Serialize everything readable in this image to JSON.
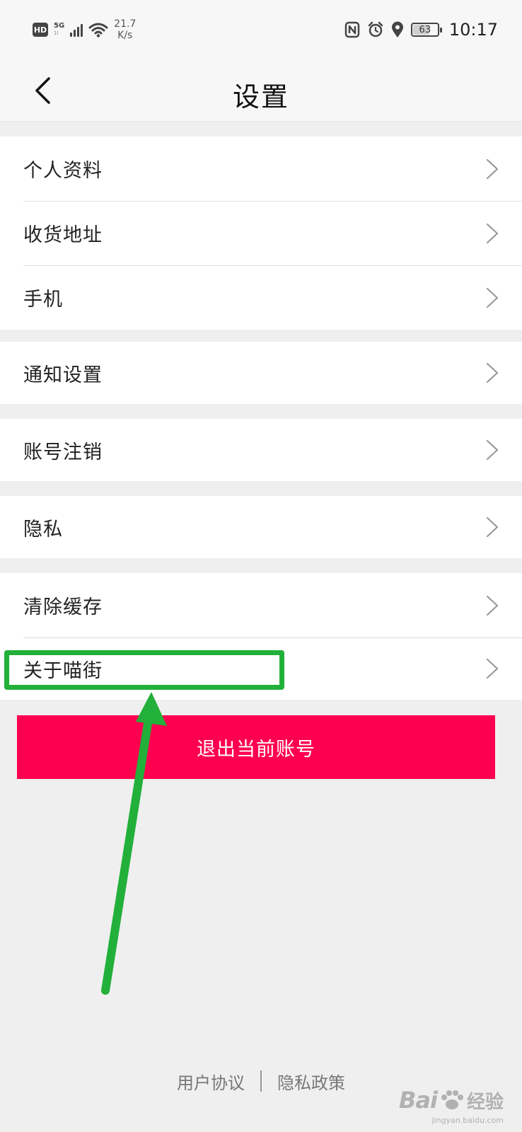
{
  "status_bar": {
    "hd": "HD",
    "network": "5G",
    "network_sub": "1l",
    "speed_value": "21.7",
    "speed_unit": "K/s",
    "battery": "63",
    "time": "10:17"
  },
  "nav": {
    "title": "设置"
  },
  "groups": [
    {
      "items": [
        {
          "label": "个人资料"
        },
        {
          "label": "收货地址"
        },
        {
          "label": "手机"
        }
      ]
    },
    {
      "items": [
        {
          "label": "通知设置"
        }
      ]
    },
    {
      "items": [
        {
          "label": "账号注销"
        }
      ]
    },
    {
      "items": [
        {
          "label": "隐私"
        }
      ]
    },
    {
      "items": [
        {
          "label": "清除缓存"
        },
        {
          "label": "关于喵街"
        }
      ]
    }
  ],
  "logout": {
    "label": "退出当前账号"
  },
  "footer": {
    "user_agreement": "用户协议",
    "privacy_policy": "隐私政策"
  },
  "watermark": {
    "brand": "Bai",
    "brand_suffix": "经验",
    "url": "jingyan.baidu.com"
  },
  "colors": {
    "accent": "#ff0050",
    "annotation": "#22b03a",
    "background": "#efefef"
  }
}
